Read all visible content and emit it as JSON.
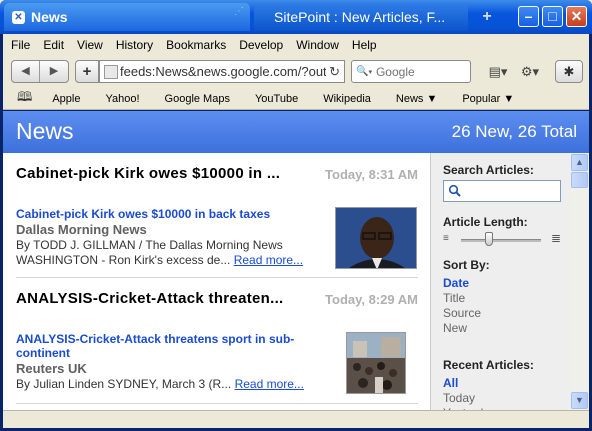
{
  "window": {
    "active_tab_title": "News",
    "inactive_tab_title": "SitePoint : New Articles, F...",
    "close_glyph": "✕",
    "new_tab_glyph": "+",
    "minimize_glyph": "–",
    "maximize_glyph": "□",
    "window_close_glyph": "✕"
  },
  "menu": [
    "File",
    "Edit",
    "View",
    "History",
    "Bookmarks",
    "Develop",
    "Window",
    "Help"
  ],
  "toolbar": {
    "back_glyph": "◀",
    "forward_glyph": "▶",
    "add_glyph": "+",
    "url": "feeds:News&news.google.com/?outp",
    "reload_glyph": "↻",
    "search_placeholder": "Google",
    "search_glyph": "🔍",
    "page_menu_glyph": "▤▾",
    "settings_glyph": "⚙▾",
    "bug_glyph": "✱"
  },
  "bookmarks": {
    "book_glyph": "🕮",
    "items": [
      "Apple",
      "Yahoo!",
      "Google Maps",
      "YouTube",
      "Wikipedia",
      "News ▼",
      "Popular ▼"
    ]
  },
  "feed": {
    "title": "News",
    "count": "26 New, 26 Total"
  },
  "articles": [
    {
      "headline": "Cabinet-pick Kirk owes $10000 in ...",
      "time": "Today, 8:31 AM",
      "link": "Cabinet-pick Kirk owes $10000 in back taxes",
      "source": "Dallas Morning News",
      "line1": "By TODD J. GILLMAN / The Dallas Morning News",
      "line2": "WASHINGTON - Ron Kirk's excess de...",
      "readmore": "Read more..."
    },
    {
      "headline": "ANALYSIS-Cricket-Attack threaten...",
      "time": "Today, 8:29 AM",
      "link_line1": "ANALYSIS-Cricket-Attack threatens sport in sub-",
      "link_line2": "continent",
      "source": "Reuters UK",
      "line1": "By Julian Linden SYDNEY, March 3 (R...",
      "readmore": "Read more..."
    }
  ],
  "sidebar": {
    "search_label": "Search Articles:",
    "length_label": "Article Length:",
    "article_length_fraction": 0.35,
    "sort_label": "Sort By:",
    "sort_options": [
      "Date",
      "Title",
      "Source",
      "New"
    ],
    "recent_label": "Recent Articles:",
    "recent_options": [
      "All",
      "Today",
      "Yesterday"
    ]
  },
  "colors": {
    "accent": "#4a7ce6",
    "link": "#1a4bd0"
  }
}
